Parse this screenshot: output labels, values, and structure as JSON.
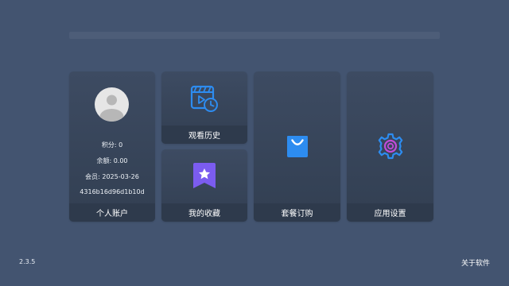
{
  "account": {
    "points": "积分: 0",
    "balance": "余额: 0.00",
    "membership": "会员: 2025-03-26",
    "device_id": "4316b16d96d1b10d",
    "label": "个人账户"
  },
  "tiles": {
    "history_label": "观看历史",
    "favorites_label": "我的收藏",
    "packages_label": "套餐订购",
    "settings_label": "应用设置"
  },
  "icons": {
    "avatar": "avatar-placeholder-icon",
    "history": "clapperboard-clock-icon",
    "favorites": "bookmark-star-icon",
    "packages": "shopping-bag-icon",
    "settings": "gear-icon"
  },
  "colors": {
    "accent_blue": "#2d8cf0",
    "accent_purple": "#7b5cf0",
    "accent_magenta": "#c24bd8"
  },
  "footer": {
    "version": "2.3.5",
    "about": "关于软件"
  }
}
